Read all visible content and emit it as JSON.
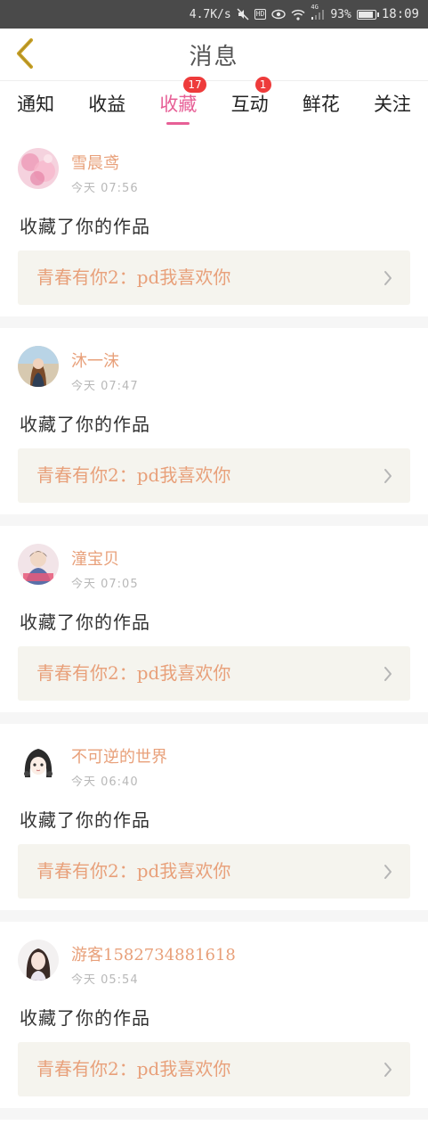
{
  "status_bar": {
    "speed": "4.7K/s",
    "hd_label": "HD",
    "network": "4G",
    "battery": "93%",
    "battery_level": 0.93,
    "time": "18:09"
  },
  "header": {
    "title": "消息"
  },
  "tabs": [
    {
      "label": "通知",
      "badge": null,
      "active": false
    },
    {
      "label": "收益",
      "badge": null,
      "active": false
    },
    {
      "label": "收藏",
      "badge": "17",
      "active": true
    },
    {
      "label": "互动",
      "badge": "1",
      "active": false
    },
    {
      "label": "鲜花",
      "badge": null,
      "active": false
    },
    {
      "label": "关注",
      "badge": null,
      "active": false
    }
  ],
  "items": [
    {
      "name": "雪晨鸢",
      "time": "今天 07:56",
      "action": "收藏了你的作品",
      "work": "青春有你2：pd我喜欢你"
    },
    {
      "name": "沐一沫",
      "time": "今天 07:47",
      "action": "收藏了你的作品",
      "work": "青春有你2：pd我喜欢你"
    },
    {
      "name": "潼宝贝",
      "time": "今天 07:05",
      "action": "收藏了你的作品",
      "work": "青春有你2：pd我喜欢你"
    },
    {
      "name": "不可逆的世界",
      "time": "今天 06:40",
      "action": "收藏了你的作品",
      "work": "青春有你2：pd我喜欢你"
    },
    {
      "name": "游客1582734881618",
      "time": "今天 05:54",
      "action": "收藏了你的作品",
      "work": "青春有你2：pd我喜欢你"
    }
  ],
  "colors": {
    "accent": "#e75f96",
    "name": "#e8a07a",
    "badge": "#ee3b3b",
    "back_arrow": "#c9a227",
    "card_bg": "#f5f4ee"
  }
}
